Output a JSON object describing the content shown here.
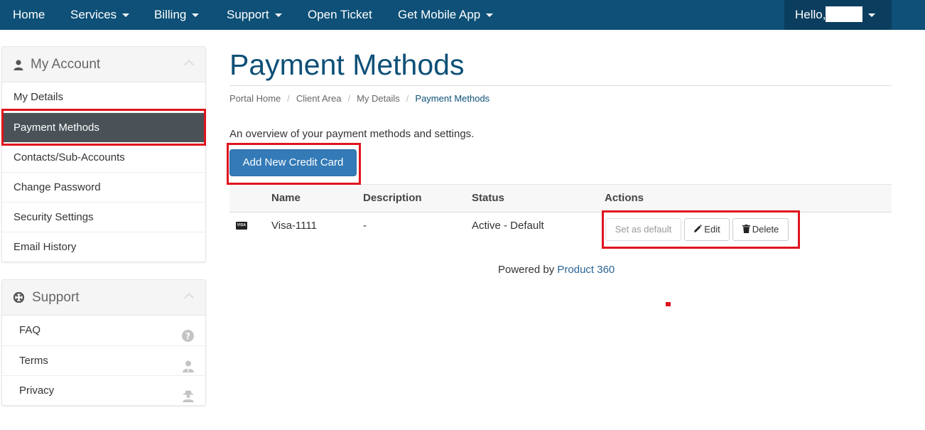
{
  "navbar": {
    "items": [
      {
        "label": "Home",
        "dropdown": false
      },
      {
        "label": "Services",
        "dropdown": true
      },
      {
        "label": "Billing",
        "dropdown": true
      },
      {
        "label": "Support",
        "dropdown": true
      },
      {
        "label": "Open Ticket",
        "dropdown": false
      },
      {
        "label": "Get Mobile App",
        "dropdown": true
      }
    ],
    "user_greeting": "Hello,"
  },
  "sidebar": {
    "account_panel": {
      "title": "My Account",
      "icon": "user-icon",
      "items": [
        {
          "label": "My Details"
        },
        {
          "label": "Payment Methods",
          "active": true
        },
        {
          "label": "Contacts/Sub-Accounts"
        },
        {
          "label": "Change Password"
        },
        {
          "label": "Security Settings"
        },
        {
          "label": "Email History"
        }
      ]
    },
    "support_panel": {
      "title": "Support",
      "icon": "life-ring-icon",
      "items": [
        {
          "label": "FAQ",
          "icon": "question-circle-icon"
        },
        {
          "label": "Terms",
          "icon": "user-tie-icon"
        },
        {
          "label": "Privacy",
          "icon": "user-secret-icon"
        }
      ]
    }
  },
  "main": {
    "title": "Payment Methods",
    "breadcrumb": [
      "Portal Home",
      "Client Area",
      "My Details",
      "Payment Methods"
    ],
    "intro": "An overview of your payment methods and settings.",
    "add_button": "Add New Credit Card",
    "table": {
      "headers": [
        "Name",
        "Description",
        "Status",
        "Actions"
      ],
      "rows": [
        {
          "card_icon": "VISA",
          "name": "Visa-1111",
          "description": "-",
          "status": "Active - Default"
        }
      ],
      "actions": {
        "set_default": "Set as default",
        "edit": "Edit",
        "delete": "Delete"
      }
    },
    "footer": {
      "prefix": "Powered by",
      "brand": "Product 360"
    }
  },
  "colors": {
    "navbar": "#0e5077",
    "navbar_user": "#0b3e5e",
    "primary_button": "#337ab7",
    "active_sidebar": "#4a5257",
    "highlight": "#e0141e",
    "title": "#0e5077"
  }
}
